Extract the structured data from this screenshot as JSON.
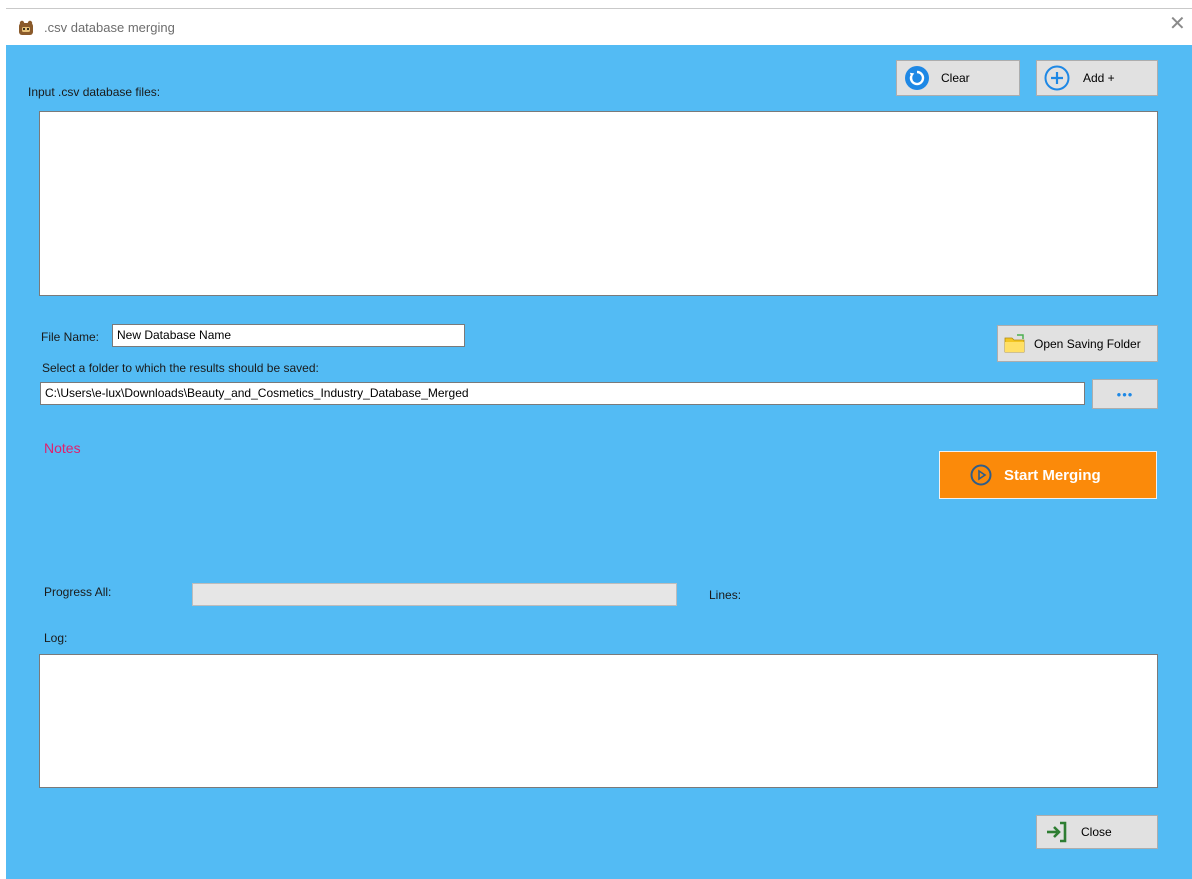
{
  "window": {
    "title": ".csv database merging",
    "close_glyph": "✕"
  },
  "icons": {
    "app": "app-logo-icon",
    "clear": "refresh-icon",
    "add": "plus-circle-icon",
    "folder": "folder-icon",
    "ellipsis": "ellipsis-icon",
    "start": "play-circle-icon",
    "close": "exit-arrow-icon"
  },
  "colors": {
    "client_background": "#53bbf4",
    "start_button": "#fb8a0a",
    "notes_text": "#e0206d",
    "icon_blue": "#1e88e5",
    "close_icon_green": "#2e7d32"
  },
  "input_section": {
    "label": "Input .csv database files:",
    "clear_button": "Clear",
    "add_button": "Add +"
  },
  "file_name": {
    "label": "File Name:",
    "value": "New Database Name"
  },
  "folder": {
    "open_button": "Open Saving Folder",
    "select_label": "Select a folder to which the results should be saved:",
    "path_value": "C:\\Users\\e-lux\\Downloads\\Beauty_and_Cosmetics_Industry_Database_Merged",
    "browse_glyph": "•••"
  },
  "notes": {
    "label": "Notes"
  },
  "start_button": {
    "label": "Start Merging"
  },
  "progress": {
    "label": "Progress All:",
    "value": 0,
    "lines_label": "Lines:"
  },
  "log": {
    "label": "Log:"
  },
  "close_button": {
    "label": "Close"
  }
}
